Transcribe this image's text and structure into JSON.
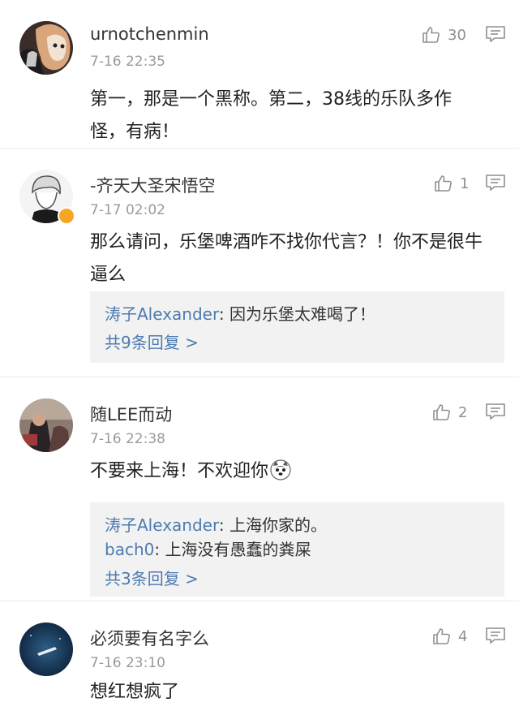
{
  "comments": [
    {
      "username": "urnotchenmin",
      "time": "7-16 22:35",
      "likes": "30",
      "body": "第一，那是一个黑称。第二，38线的乐队多作怪，有病！",
      "body_lines": [
        "第一，那是一个黑称。第二，38线的乐队多作",
        "怪，有病！"
      ]
    },
    {
      "username": "-齐天大圣宋悟空",
      "time": "7-17 02:02",
      "likes": "1",
      "body_lines": [
        "那么请问，乐堡啤酒咋不找你代言？！你不是很牛",
        "逼么"
      ],
      "replies": [
        {
          "user": "涛子Alexander",
          "text": ": 因为乐堡太难喝了！"
        }
      ],
      "more": "共9条回复 >"
    },
    {
      "username": "随LEE而动",
      "time": "7-16 22:38",
      "likes": "2",
      "body_lines": [
        "不要来上海！不欢迎你"
      ],
      "replies": [
        {
          "user": "涛子Alexander",
          "text": ": 上海你家的。"
        },
        {
          "user": "bach0",
          "text": ": 上海没有愚蠢的粪屎"
        }
      ],
      "more": "共3条回复 >"
    },
    {
      "username": "必须要有名字么",
      "time": "7-16 23:10",
      "likes": "4",
      "body_lines": [
        "想红想疯了"
      ]
    }
  ],
  "icons": {
    "like": "thumbs-up-icon",
    "reply": "comment-bubble-icon",
    "verified": "verified-badge-icon",
    "emoji": "husky-emoji-icon"
  },
  "colors": {
    "link": "#4d7bb0",
    "meta": "#9b9b9b",
    "reply_bg": "#f2f2f2"
  }
}
